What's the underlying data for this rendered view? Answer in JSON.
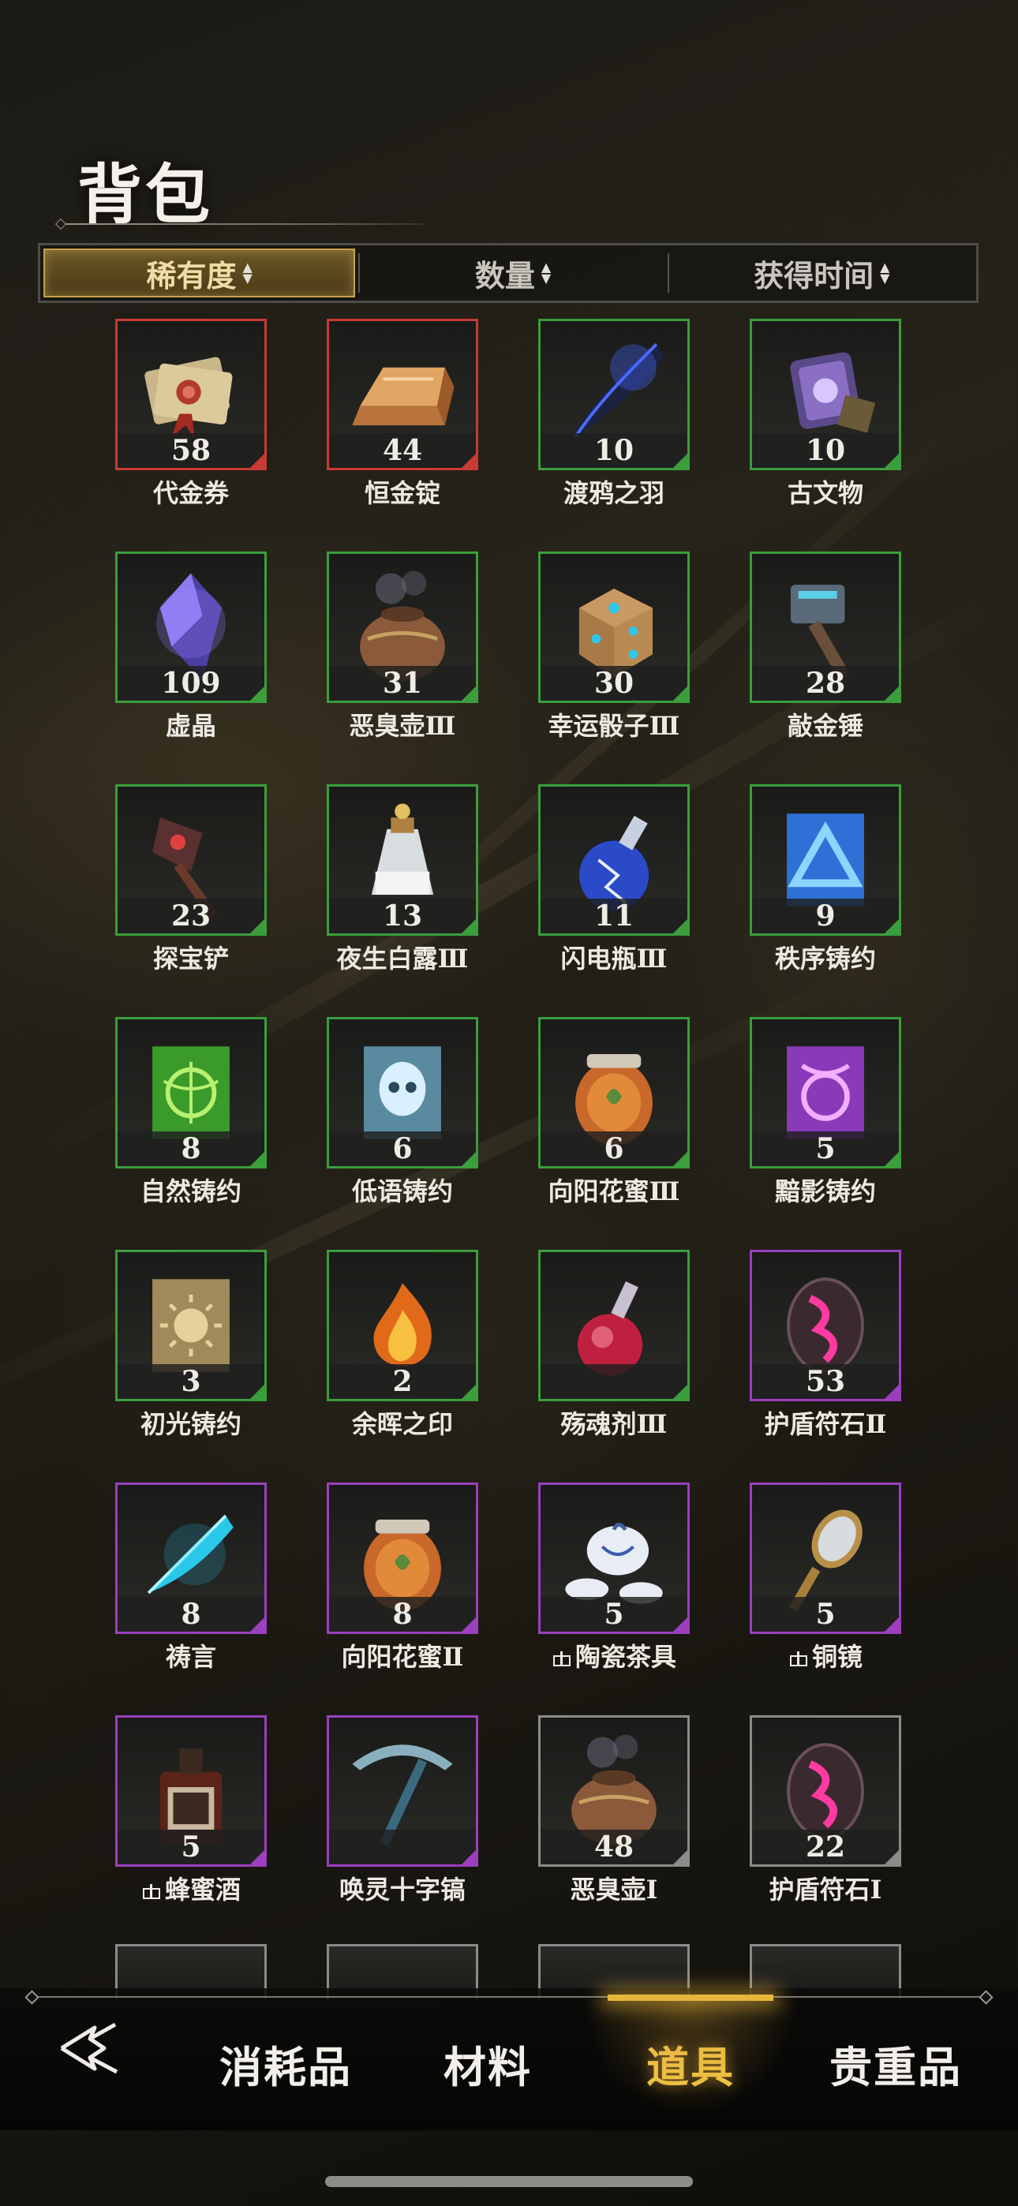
{
  "header": {
    "title": "背包"
  },
  "sort": [
    {
      "label": "稀有度",
      "active": true
    },
    {
      "label": "数量",
      "active": false
    },
    {
      "label": "获得时间",
      "active": false
    }
  ],
  "items": [
    {
      "name": "代金券",
      "count": "58",
      "rarity": "red",
      "icon": "voucher-icon",
      "gift": false
    },
    {
      "name": "恒金锭",
      "count": "44",
      "rarity": "red",
      "icon": "gold-ingot-icon",
      "gift": false
    },
    {
      "name": "渡鸦之羽",
      "count": "10",
      "rarity": "green",
      "icon": "raven-feather-icon",
      "gift": false
    },
    {
      "name": "古文物",
      "count": "10",
      "rarity": "green",
      "icon": "relic-icon",
      "gift": false
    },
    {
      "name": "虚晶",
      "count": "109",
      "rarity": "green",
      "icon": "void-crystal-icon",
      "gift": false
    },
    {
      "name": "恶臭壶Ⅲ",
      "count": "31",
      "rarity": "green",
      "icon": "stink-pot-icon",
      "gift": false
    },
    {
      "name": "幸运骰子Ⅲ",
      "count": "30",
      "rarity": "green",
      "icon": "lucky-dice-icon",
      "gift": false
    },
    {
      "name": "敲金锤",
      "count": "28",
      "rarity": "green",
      "icon": "hammer-icon",
      "gift": false
    },
    {
      "name": "探宝铲",
      "count": "23",
      "rarity": "green",
      "icon": "shovel-icon",
      "gift": false
    },
    {
      "name": "夜生白露Ⅲ",
      "count": "13",
      "rarity": "green",
      "icon": "dew-flask-icon",
      "gift": false
    },
    {
      "name": "闪电瓶Ⅲ",
      "count": "11",
      "rarity": "green",
      "icon": "lightning-bottle-icon",
      "gift": false
    },
    {
      "name": "秩序铸约",
      "count": "9",
      "rarity": "green",
      "icon": "order-pact-icon",
      "gift": false
    },
    {
      "name": "自然铸约",
      "count": "8",
      "rarity": "green",
      "icon": "nature-pact-icon",
      "gift": false
    },
    {
      "name": "低语铸约",
      "count": "6",
      "rarity": "green",
      "icon": "whisper-pact-icon",
      "gift": false
    },
    {
      "name": "向阳花蜜Ⅲ",
      "count": "6",
      "rarity": "green",
      "icon": "honey-jar-icon",
      "gift": false
    },
    {
      "name": "黯影铸约",
      "count": "5",
      "rarity": "green",
      "icon": "shadow-pact-icon",
      "gift": false
    },
    {
      "name": "初光铸约",
      "count": "3",
      "rarity": "green",
      "icon": "dawn-pact-icon",
      "gift": false
    },
    {
      "name": "余晖之印",
      "count": "2",
      "rarity": "green",
      "icon": "ember-seal-icon",
      "gift": false
    },
    {
      "name": "殇魂剂Ⅲ",
      "count": "",
      "rarity": "green",
      "icon": "soul-potion-icon",
      "gift": false
    },
    {
      "name": "护盾符石Ⅱ",
      "count": "53",
      "rarity": "purple",
      "icon": "shield-rune-icon",
      "gift": false
    },
    {
      "name": "祷言",
      "count": "8",
      "rarity": "purple",
      "icon": "prayer-icon",
      "gift": false
    },
    {
      "name": "向阳花蜜Ⅱ",
      "count": "8",
      "rarity": "purple",
      "icon": "honey-jar-icon",
      "gift": false
    },
    {
      "name": "陶瓷茶具",
      "count": "5",
      "rarity": "purple",
      "icon": "tea-set-icon",
      "gift": true
    },
    {
      "name": "铜镜",
      "count": "5",
      "rarity": "purple",
      "icon": "bronze-mirror-icon",
      "gift": true
    },
    {
      "name": "蜂蜜酒",
      "count": "5",
      "rarity": "purple",
      "icon": "mead-bottle-icon",
      "gift": true
    },
    {
      "name": "唤灵十字镐",
      "count": "",
      "rarity": "purple",
      "icon": "pickaxe-icon",
      "gift": false
    },
    {
      "name": "恶臭壶Ⅰ",
      "count": "48",
      "rarity": "grey",
      "icon": "stink-pot-icon",
      "gift": false
    },
    {
      "name": "护盾符石Ⅰ",
      "count": "22",
      "rarity": "grey",
      "icon": "shield-rune-icon",
      "gift": false
    }
  ],
  "nav": {
    "back_icon": "back-arrow-icon",
    "tabs": [
      {
        "label": "消耗品",
        "active": false
      },
      {
        "label": "材料",
        "active": false
      },
      {
        "label": "道具",
        "active": true
      },
      {
        "label": "贵重品",
        "active": false
      }
    ]
  },
  "colors": {
    "red": "#c83a34",
    "green": "#3a9e3c",
    "purple": "#9b3fbe",
    "grey": "#8b8b8b",
    "accent": "#f1c445"
  }
}
